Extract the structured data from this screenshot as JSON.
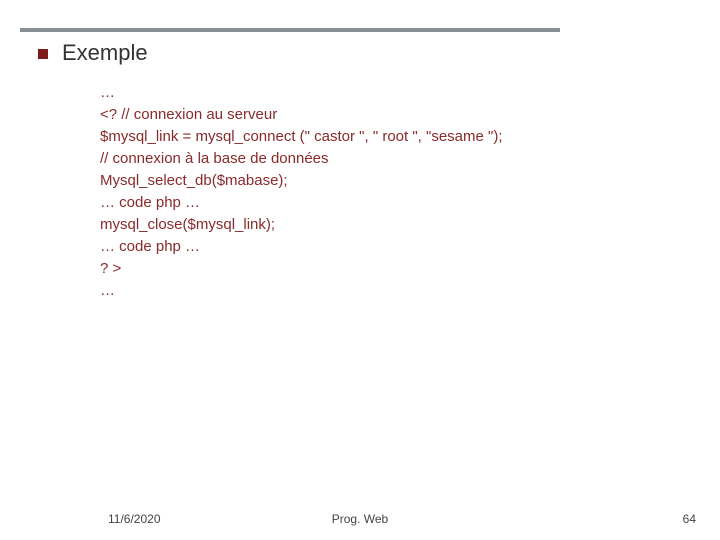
{
  "title": "Exemple",
  "code": {
    "l0": "…",
    "l1": "<?  // connexion au serveur",
    "l2": "$mysql_link = mysql_connect (\" castor \", \" root \", \"sesame \");",
    "l3": "// connexion à la base de données",
    "l4": "Mysql_select_db($mabase);",
    "l5": "… code php …",
    "l6": "mysql_close($mysql_link);",
    "l7": "… code php …",
    "l8": "? >",
    "l9": "…"
  },
  "footer": {
    "date": "11/6/2020",
    "center": "Prog. Web",
    "page": "64"
  }
}
